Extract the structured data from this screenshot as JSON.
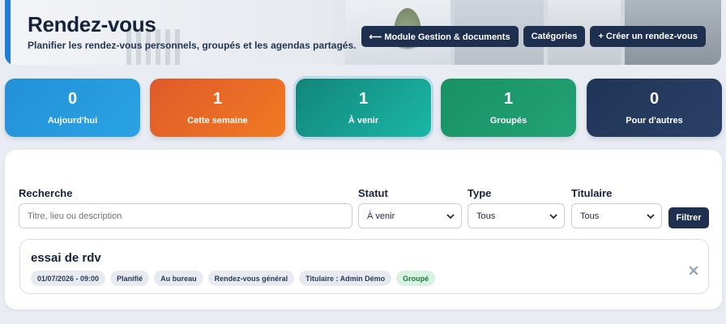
{
  "header": {
    "title": "Rendez-vous",
    "subtitle": "Planifier les rendez-vous personnels, groupés et les agendas partagés.",
    "buttons": [
      {
        "label": "⟵ Module Gestion & documents"
      },
      {
        "label": "Catégories"
      },
      {
        "label": "+ Créer un rendez-vous"
      }
    ]
  },
  "stats": [
    {
      "value": "0",
      "label": "Aujourd'hui",
      "color": "#2390d8"
    },
    {
      "value": "1",
      "label": "Cette semaine",
      "color": "#e96a26"
    },
    {
      "value": "1",
      "label": "À venir",
      "color": "#16a091"
    },
    {
      "value": "1",
      "label": "Groupés",
      "color": "#1d9a6e"
    },
    {
      "value": "0",
      "label": "Pour d'autres",
      "color": "#243a5e"
    }
  ],
  "filters": {
    "search": {
      "label": "Recherche",
      "placeholder": "Titre, lieu ou description",
      "value": ""
    },
    "status": {
      "label": "Statut",
      "selected": "À venir"
    },
    "type": {
      "label": "Type",
      "selected": "Tous"
    },
    "owner": {
      "label": "Titulaire",
      "selected": "Tous"
    },
    "submit_label": "Filtrer"
  },
  "appointments": [
    {
      "title": "essai de rdv",
      "tags": [
        {
          "text": "01/07/2026 - 09:00"
        },
        {
          "text": "Planifié"
        },
        {
          "text": "Au bureau"
        },
        {
          "text": "Rendez-vous général"
        },
        {
          "text": "Titulaire : Admin Démo"
        },
        {
          "text": "Groupé",
          "style": "green"
        }
      ]
    }
  ],
  "icons": {
    "close": "close-icon",
    "select_arrow": "chevron-down-icon"
  }
}
